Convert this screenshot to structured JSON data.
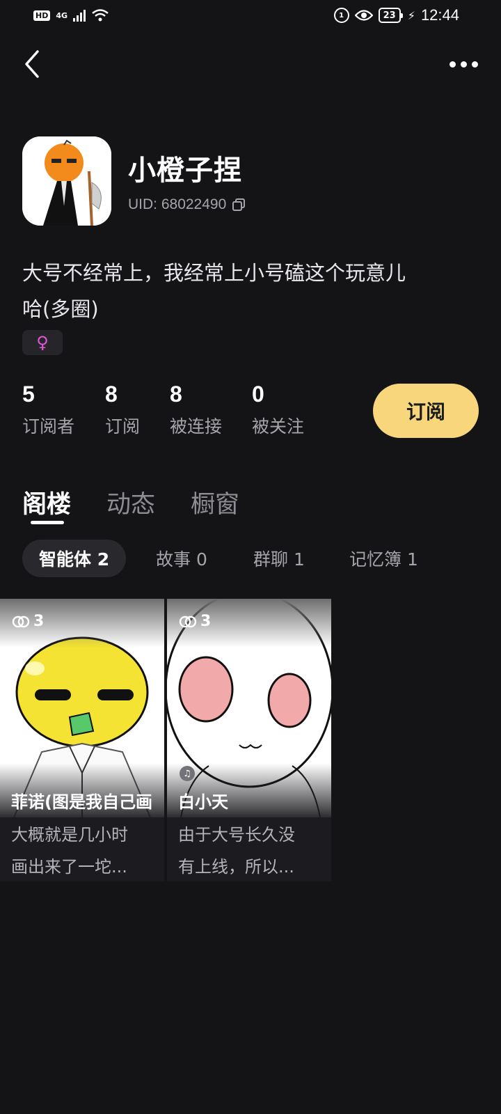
{
  "status_bar": {
    "hd": "HD",
    "signal": "4G",
    "sync_icon": "1",
    "battery": "23",
    "time": "12:44"
  },
  "profile": {
    "username": "小橙子捏",
    "uid": "UID: 68022490",
    "bio_line1": "大号不经常上，我经常上小号磕这个玩意儿",
    "bio_line2": "哈(多圈)",
    "gender_symbol": "♀",
    "gender_color": "#e255d8"
  },
  "stats": [
    {
      "value": "5",
      "label": "订阅者"
    },
    {
      "value": "8",
      "label": "订阅"
    },
    {
      "value": "8",
      "label": "被连接"
    },
    {
      "value": "0",
      "label": "被关注"
    }
  ],
  "subscribe_label": "订阅",
  "tabs": [
    {
      "label": "阁楼",
      "active": true
    },
    {
      "label": "动态",
      "active": false
    },
    {
      "label": "橱窗",
      "active": false
    }
  ],
  "chips": [
    {
      "label": "智能体 2",
      "active": true
    },
    {
      "label": "故事 0",
      "active": false
    },
    {
      "label": "群聊 1",
      "active": false
    },
    {
      "label": "记忆簿 1",
      "active": false
    }
  ],
  "cards": [
    {
      "count": "3",
      "title": "菲诺(图是我自己画",
      "desc_line1": "大概就是几小时",
      "desc_line2": "画出来了一坨..."
    },
    {
      "count": "3",
      "title": "白小天",
      "desc_line1": "由于大号长久没",
      "desc_line2": "有上线，所以..."
    }
  ],
  "colors": {
    "background": "#141316",
    "accent": "#f8d77c"
  }
}
